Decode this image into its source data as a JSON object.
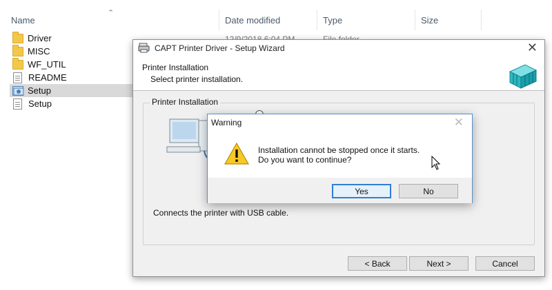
{
  "explorer": {
    "columns": {
      "name": "Name",
      "date_modified": "Date modified",
      "type": "Type",
      "size": "Size"
    },
    "partial_row": {
      "date": "12/9/2018 6:04 PM",
      "type": "File folder"
    },
    "files": [
      {
        "name": "Driver",
        "icon": "folder-icon"
      },
      {
        "name": "MISC",
        "icon": "folder-icon"
      },
      {
        "name": "WF_UTIL",
        "icon": "folder-icon"
      },
      {
        "name": "README",
        "icon": "document-icon"
      },
      {
        "name": "Setup",
        "icon": "setup-app-icon",
        "selected": true
      },
      {
        "name": "Setup",
        "icon": "setup-config-icon"
      }
    ]
  },
  "wizard": {
    "title": "CAPT Printer Driver - Setup Wizard",
    "header_title": "Printer Installation",
    "header_subtitle": "Select printer installation.",
    "group_label": "Printer Installation",
    "connect_text": "Connects the printer with USB cable.",
    "buttons": {
      "back": "< Back",
      "next": "Next >",
      "cancel": "Cancel"
    }
  },
  "warning": {
    "title": "Warning",
    "message_line1": "Installation cannot be stopped once it starts.",
    "message_line2": "Do you want to continue?",
    "buttons": {
      "yes": "Yes",
      "no": "No"
    }
  },
  "colors": {
    "selection": "#d9d9d9",
    "dialog_border": "#5a8fc7",
    "default_button_border": "#2f7fd0",
    "warning_yellow": "#f6c928"
  }
}
